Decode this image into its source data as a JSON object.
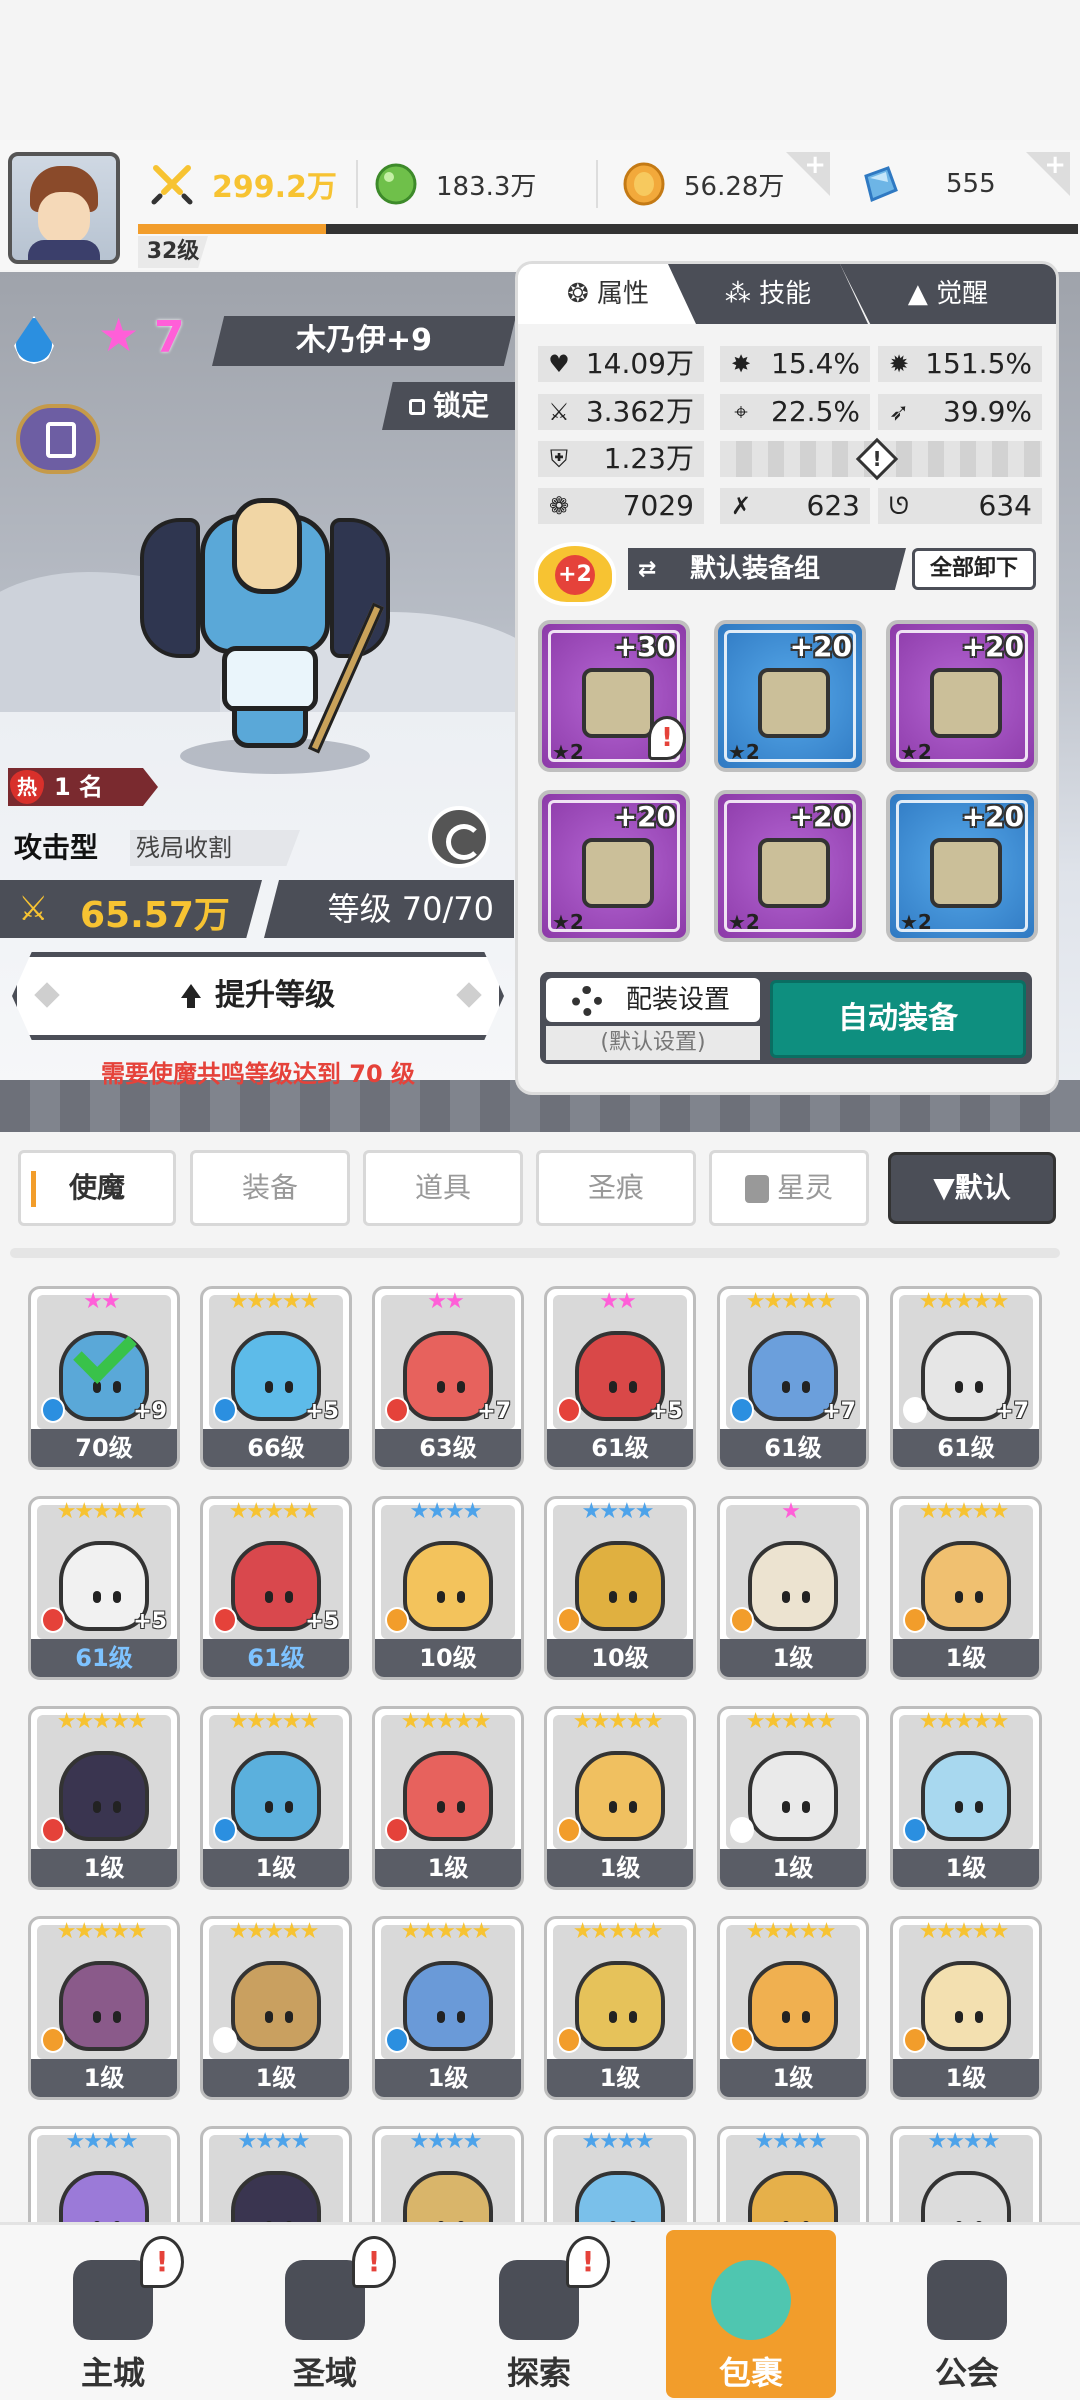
{
  "player": {
    "level": "32级",
    "xp_fraction": 0.2
  },
  "resources": [
    {
      "value": "299.2万",
      "icon": "swords-power-icon",
      "color": "#f7c332"
    },
    {
      "value": "183.3万",
      "icon": "green-orb-icon",
      "color": "#6fc04a"
    },
    {
      "value": "56.28万",
      "icon": "gold-coin-icon",
      "color": "#f2a93b",
      "has_plus": true
    },
    {
      "value": "555",
      "icon": "blue-gem-icon",
      "color": "#6db5e6",
      "has_plus": true
    }
  ],
  "hero": {
    "star_count": "7",
    "name": "木乃伊+9",
    "lock_label": "锁定",
    "rank_prefix": "热",
    "rank_label": "1 名",
    "type": "攻击型",
    "type_desc": "残局收割",
    "power": "65.57万",
    "level": "等级 70/70",
    "upgrade_label": "提升等级",
    "requirement": "需要使魔共鸣等级达到 70 级"
  },
  "panel": {
    "tabs": [
      "属性",
      "技能",
      "觉醒"
    ],
    "stats": {
      "hp": "14.09万",
      "crit": "15.4%",
      "crit_dmg": "151.5%",
      "attack": "3.362万",
      "accuracy": "22.5%",
      "speed": "39.9%",
      "defense": "1.23万",
      "stat_a": "7029",
      "stat_b": "623",
      "stat_c": "634"
    },
    "set_bonus": "+2",
    "set_name": "默认装备组",
    "unequip_all": "全部卸下",
    "equipment": [
      {
        "plus": "+30",
        "stars": "★2",
        "rarity": "purple",
        "alert": "!"
      },
      {
        "plus": "+20",
        "stars": "★2",
        "rarity": "blue"
      },
      {
        "plus": "+20",
        "stars": "★2",
        "rarity": "purple"
      },
      {
        "plus": "+20",
        "stars": "★2",
        "rarity": "purple"
      },
      {
        "plus": "+20",
        "stars": "★2",
        "rarity": "purple"
      },
      {
        "plus": "+20",
        "stars": "★2",
        "rarity": "blue"
      }
    ],
    "config_label": "配装设置",
    "config_sub": "(默认设置)",
    "auto_equip": "自动装备"
  },
  "categories": [
    "使魔",
    "装备",
    "道具",
    "圣痕",
    "星灵"
  ],
  "sort_label": "▼默认",
  "heroes": [
    {
      "stars": "★★",
      "star_color": "#ff5fd8",
      "level": "70级",
      "elem": "water",
      "plus": "+9",
      "art": "#5aa8d8",
      "selected": true
    },
    {
      "stars": "★★★★★",
      "star_color": "#f7c332",
      "level": "66级",
      "elem": "water",
      "plus": "+5",
      "art": "#5dbbe9"
    },
    {
      "stars": "★★",
      "star_color": "#ff5fd8",
      "level": "63级",
      "elem": "fire",
      "plus": "+7",
      "art": "#e7625d"
    },
    {
      "stars": "★★",
      "star_color": "#ff5fd8",
      "level": "61级",
      "elem": "fire",
      "plus": "+5",
      "art": "#d94848"
    },
    {
      "stars": "★★★★★",
      "star_color": "#f7c332",
      "level": "61级",
      "elem": "water",
      "plus": "+7",
      "art": "#6b9fdc"
    },
    {
      "stars": "★★★★★",
      "star_color": "#f7c332",
      "level": "61级",
      "elem": "light",
      "plus": "+7",
      "art": "#e6e6e6"
    },
    {
      "stars": "★★★★★",
      "star_color": "#f7c332",
      "level": "61级",
      "elem": "fire",
      "plus": "+5",
      "art": "#f1f1f1",
      "blue": true
    },
    {
      "stars": "★★★★★",
      "star_color": "#f7c332",
      "level": "61级",
      "elem": "fire",
      "plus": "+5",
      "art": "#d9484d",
      "blue": true
    },
    {
      "stars": "★★★★",
      "star_color": "#4da3ea",
      "level": "10级",
      "elem": "wind",
      "art": "#f3c35c"
    },
    {
      "stars": "★★★★",
      "star_color": "#4da3ea",
      "level": "10级",
      "elem": "wind",
      "art": "#e0b040"
    },
    {
      "stars": "★",
      "star_color": "#ff5fd8",
      "level": "1级",
      "elem": "wind",
      "art": "#ece3d0"
    },
    {
      "stars": "★★★★★",
      "star_color": "#f7c332",
      "level": "1级",
      "elem": "wind",
      "art": "#f0c070"
    },
    {
      "stars": "★★★★★",
      "star_color": "#f7c332",
      "level": "1级",
      "elem": "fire",
      "art": "#3a3550"
    },
    {
      "stars": "★★★★★",
      "star_color": "#f7c332",
      "level": "1级",
      "elem": "water",
      "art": "#5bb0dd"
    },
    {
      "stars": "★★★★★",
      "star_color": "#f7c332",
      "level": "1级",
      "elem": "fire",
      "art": "#e7625d"
    },
    {
      "stars": "★★★★★",
      "star_color": "#f7c332",
      "level": "1级",
      "elem": "wind",
      "art": "#f0c060"
    },
    {
      "stars": "★★★★★",
      "star_color": "#f7c332",
      "level": "1级",
      "elem": "light",
      "art": "#eaeaea"
    },
    {
      "stars": "★★★★★",
      "star_color": "#f7c332",
      "level": "1级",
      "elem": "water",
      "art": "#a8d8ef"
    },
    {
      "stars": "★★★★★",
      "star_color": "#f7c332",
      "level": "1级",
      "elem": "wind",
      "art": "#8a5a8a"
    },
    {
      "stars": "★★★★★",
      "star_color": "#f7c332",
      "level": "1级",
      "elem": "light",
      "art": "#c9a060"
    },
    {
      "stars": "★★★★★",
      "star_color": "#f7c332",
      "level": "1级",
      "elem": "water",
      "art": "#6a9ad8"
    },
    {
      "stars": "★★★★★",
      "star_color": "#f7c332",
      "level": "1级",
      "elem": "wind",
      "art": "#e6c25a"
    },
    {
      "stars": "★★★★★",
      "star_color": "#f7c332",
      "level": "1级",
      "elem": "wind",
      "art": "#f0b050"
    },
    {
      "stars": "★★★★★",
      "star_color": "#f7c332",
      "level": "1级",
      "elem": "wind",
      "art": "#f3e0b0"
    },
    {
      "stars": "★★★★",
      "star_color": "#4da3ea",
      "level": "",
      "elem": "",
      "art": "#9b7ad8"
    },
    {
      "stars": "★★★★",
      "star_color": "#4da3ea",
      "level": "",
      "elem": "",
      "art": "#3a3550"
    },
    {
      "stars": "★★★★",
      "star_color": "#4da3ea",
      "level": "",
      "elem": "",
      "art": "#d9b56a"
    },
    {
      "stars": "★★★★",
      "star_color": "#4da3ea",
      "level": "",
      "elem": "",
      "art": "#7ac0ea"
    },
    {
      "stars": "★★★★",
      "star_color": "#4da3ea",
      "level": "",
      "elem": "",
      "art": "#e6b04a"
    },
    {
      "stars": "★★★★",
      "star_color": "#4da3ea",
      "level": "",
      "elem": "",
      "art": "#dcdcdc"
    }
  ],
  "nav": [
    {
      "label": "主城",
      "icon": "castle-icon",
      "alert": "!"
    },
    {
      "label": "圣域",
      "icon": "vortex-icon",
      "alert": "!"
    },
    {
      "label": "探索",
      "icon": "sword-anvil-icon",
      "alert": "!"
    },
    {
      "label": "包裹",
      "icon": "backpack-icon",
      "active": true
    },
    {
      "label": "公会",
      "icon": "guild-icon"
    }
  ],
  "colors": {
    "accent": "#f29d2b",
    "teal": "#0e8f7f",
    "dark": "#4b4e57",
    "warn": "#e5423a"
  }
}
